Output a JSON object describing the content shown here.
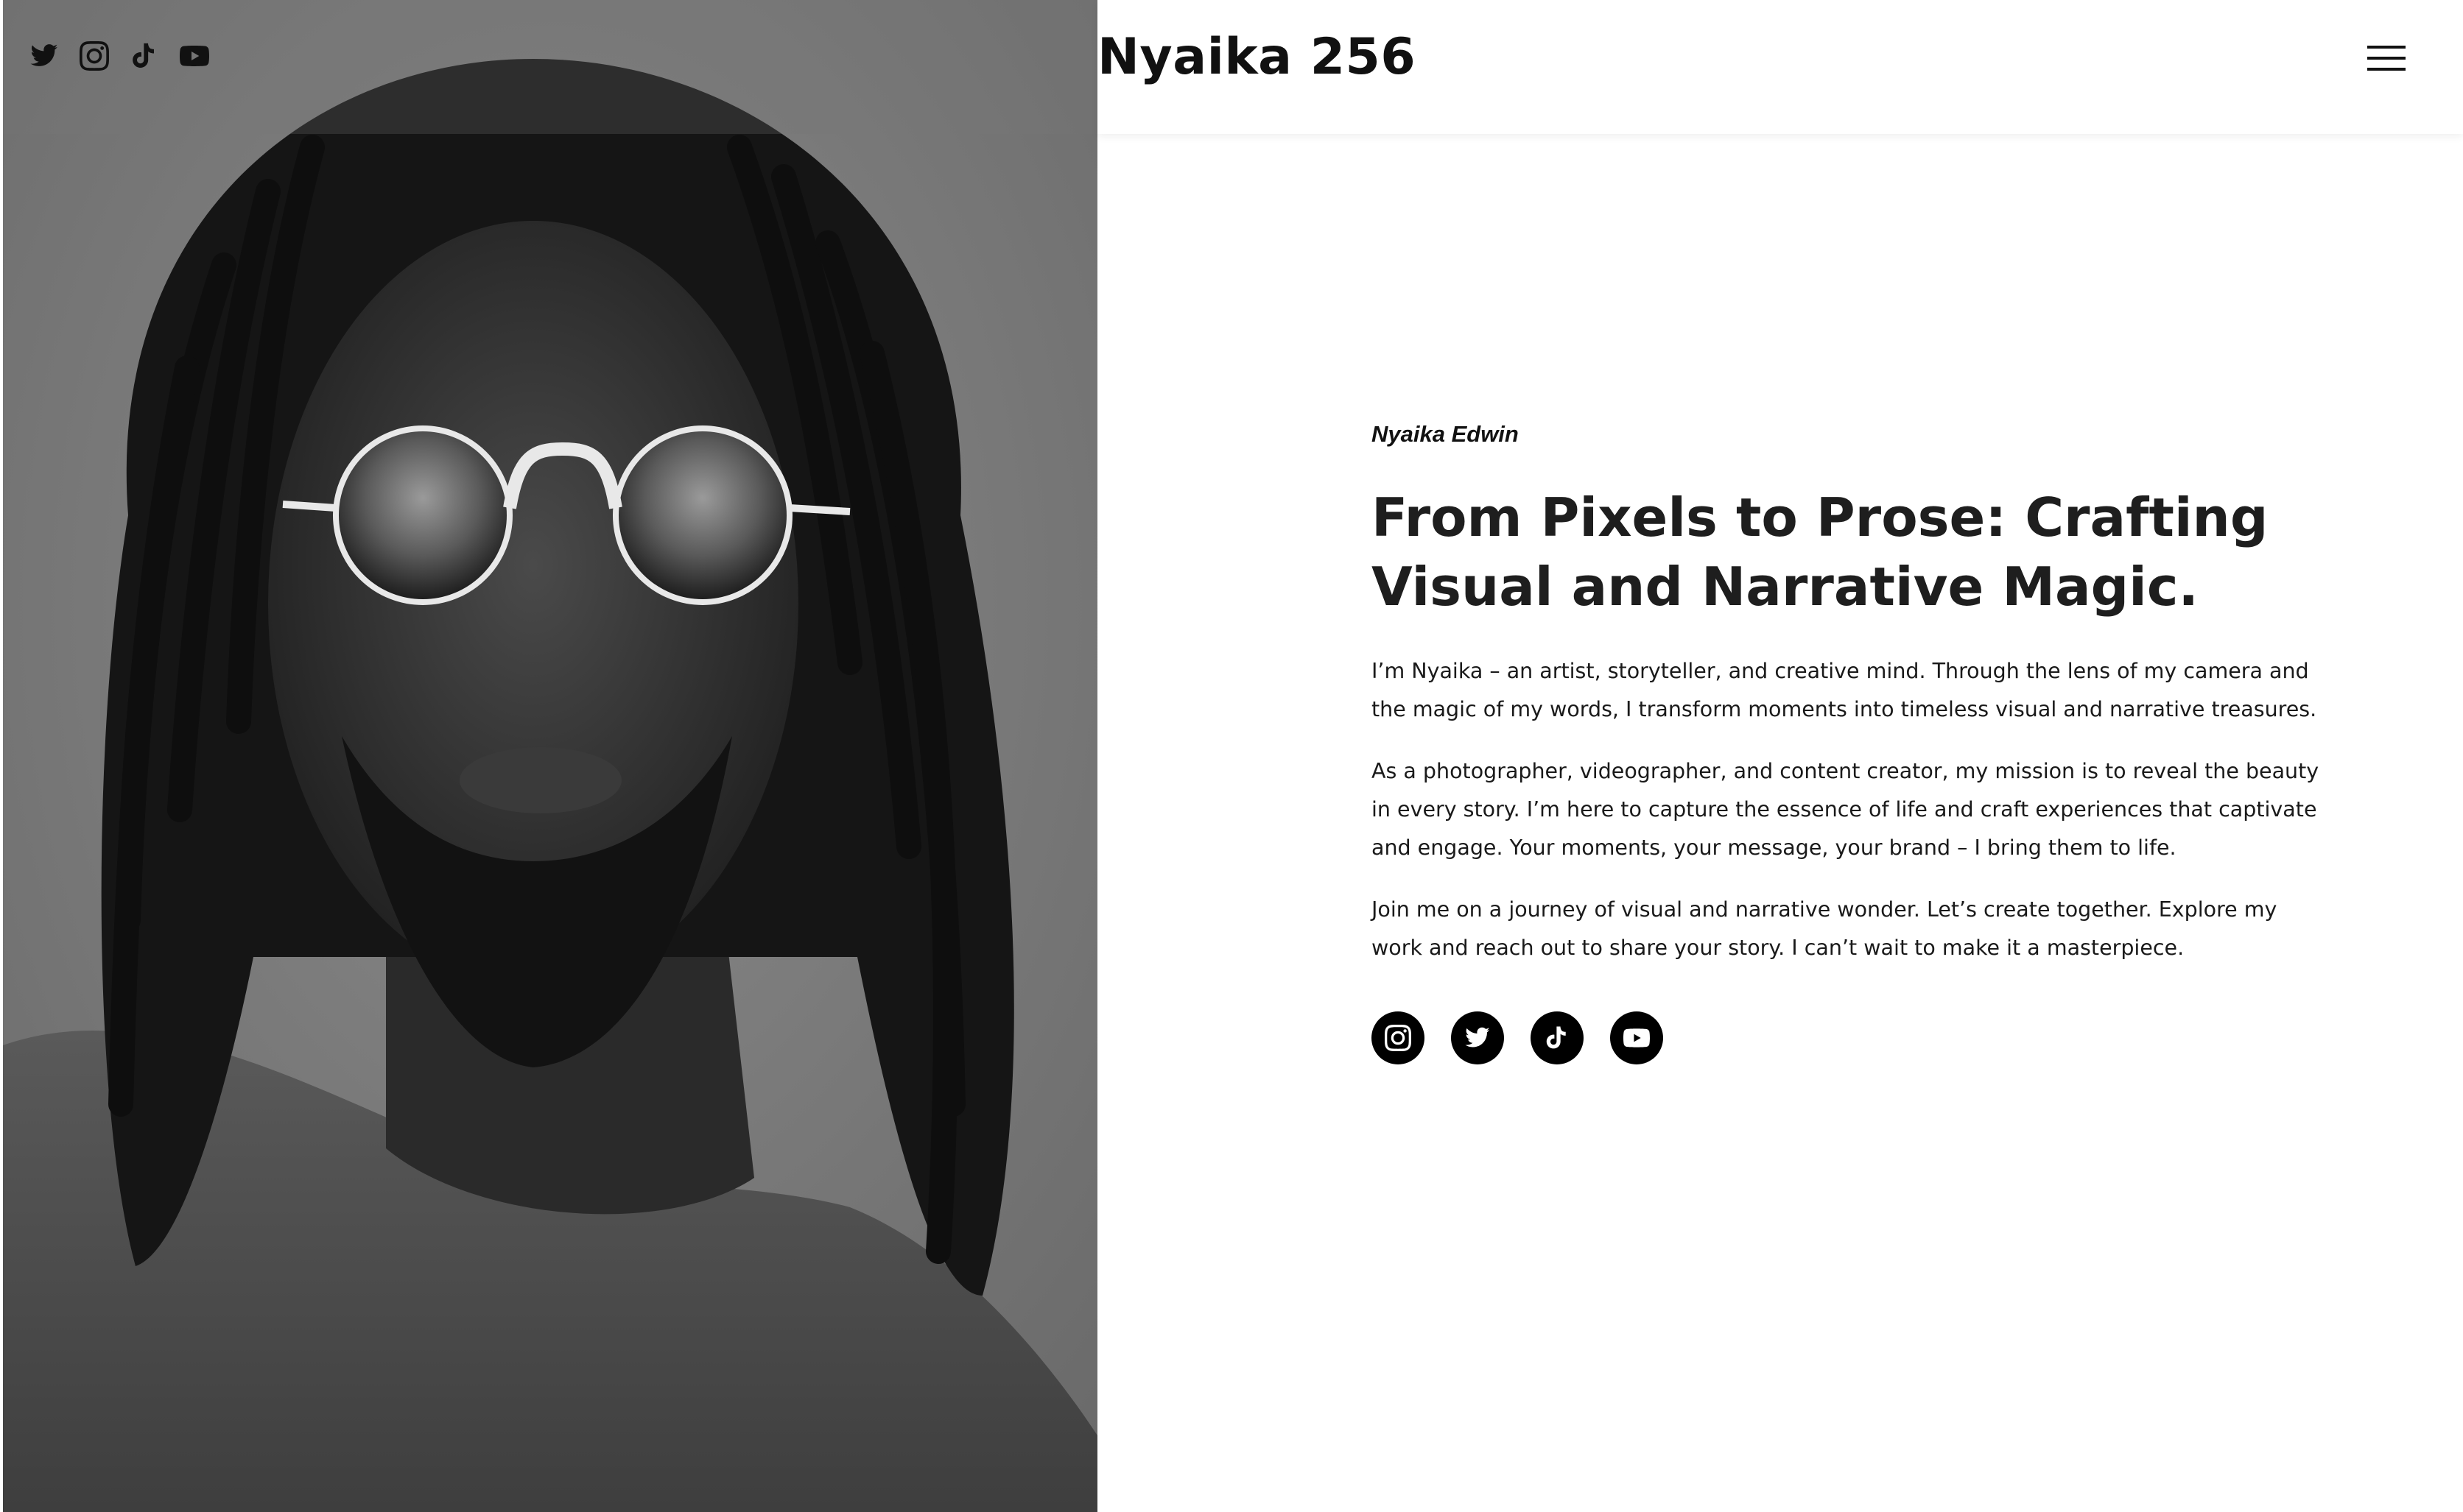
{
  "header": {
    "site_title": "Nyaika 256",
    "social_icons": [
      "twitter-icon",
      "instagram-icon",
      "tiktok-icon",
      "youtube-icon"
    ],
    "menu_icon": "hamburger-menu-icon"
  },
  "hero": {
    "image_description_icon": "portrait-photo",
    "eyebrow": "Nyaika Edwin",
    "headline": "From Pixels to Prose: Crafting Visual and Narrative Magic.",
    "paragraphs": [
      "I’m Nyaika – an artist, storyteller, and creative mind. Through the lens of my camera and the magic of my words, I transform moments into timeless visual and narrative treasures.",
      "As a photographer, videographer, and content creator, my mission is to reveal the beauty in every story. I’m here to capture the essence of life and craft experiences that captivate and engage. Your moments, your message, your brand – I bring them to life.",
      "Join me on a journey of visual and narrative wonder. Let’s create together. Explore my work and reach out to share your story. I can’t wait to make it a masterpiece."
    ],
    "social_icons": [
      "instagram-icon",
      "twitter-icon",
      "tiktok-icon",
      "youtube-icon"
    ]
  },
  "colors": {
    "background": "#ffffff",
    "text": "#111111",
    "portrait_bg": "#7c7c7c",
    "social_circle": "#000000"
  }
}
